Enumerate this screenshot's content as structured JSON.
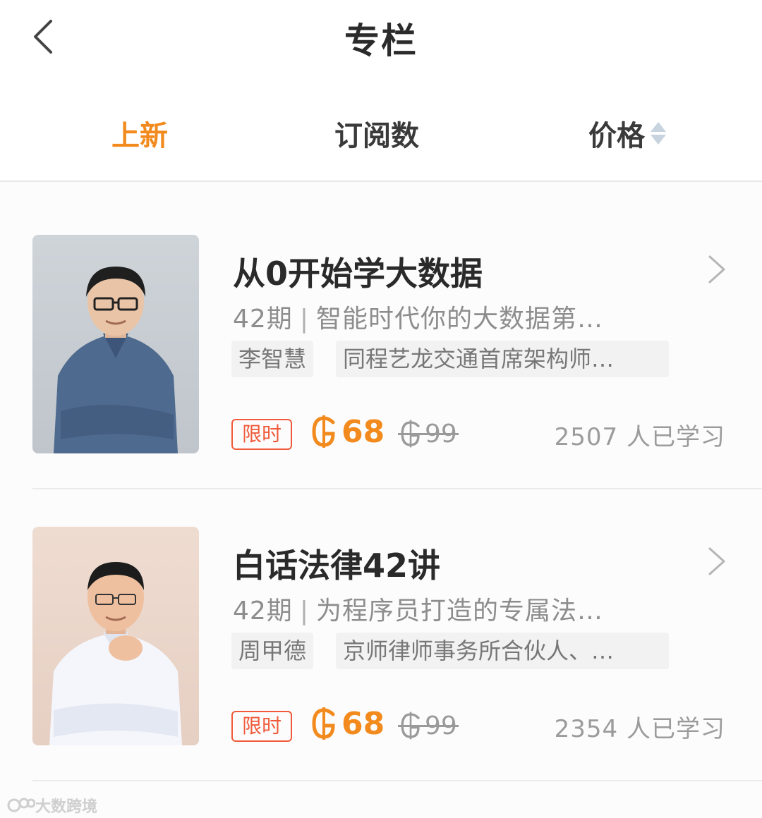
{
  "header": {
    "title": "专栏"
  },
  "tabs": [
    {
      "label": "上新",
      "active": true
    },
    {
      "label": "订阅数",
      "active": false
    },
    {
      "label": "价格",
      "active": false
    }
  ],
  "colors": {
    "accent": "#f28a1d",
    "badge": "#f05a3a",
    "muted": "#9b9b9b"
  },
  "courses": [
    {
      "title": "从0开始学大数据",
      "issues": "42期",
      "separator": "|",
      "desc": "智能时代你的大数据第…",
      "author": "李智慧",
      "author_bio": "同程艺龙交通首席架构师…",
      "badge": "限时",
      "price": "68",
      "original_price": "99",
      "learners": "2507 人已学习"
    },
    {
      "title": "白话法律42讲",
      "issues": "42期",
      "separator": "|",
      "desc": "为程序员打造的专属法…",
      "author": "周甲德",
      "author_bio": "京师律师事务所合伙人、…",
      "badge": "限时",
      "price": "68",
      "original_price": "99",
      "learners": "2354 人已学习"
    }
  ],
  "watermark": "大数跨境"
}
